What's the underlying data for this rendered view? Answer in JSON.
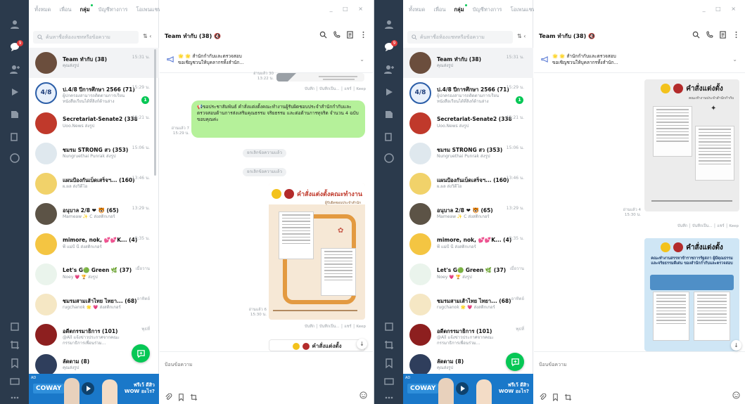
{
  "colors": {
    "rail": "#2b3a4c",
    "accent": "#06c755",
    "bubble": "#b5f19a",
    "badge": "#e23b3b",
    "adBlue": "#1a78c9"
  },
  "nav": {
    "tabs": [
      "ทั้งหมด",
      "เพื่อน",
      "กลุ่ม",
      "บัญชีทางการ",
      "โอเพนแชท",
      "⇄"
    ]
  },
  "search": {
    "placeholder": "ค้นหาชื่อห้องแชทหรือข้อความ"
  },
  "rail_badge": "9",
  "chats": [
    {
      "name": "Team ทำกับ (38)",
      "sub": "คุณส่งรูป",
      "time": "15:31 น."
    },
    {
      "name": "ป.4/8 ปีการศึกษา 2566 (71)",
      "sub": "ผู้ปกครองสามารถติดตามการเรียน หนังสือเรียนได้ที่ลิงก์ด้านล่าง",
      "time": "15:29 น.",
      "unread": "1",
      "logo": "4/8"
    },
    {
      "name": "Secretariat-Senate2 (338)",
      "sub": "Uoo.News ส่งรูป",
      "time": "15:21 น."
    },
    {
      "name": "ชมรม STRONG สว (353)",
      "sub": "Nungruethai Punrak ส่งรูป",
      "time": "15:06 น."
    },
    {
      "name": "แผนป้องกันเบ็ดเสร็จฯ... (160)",
      "sub": "ผ.ผล ส่งวิดีโอ",
      "time": "13:46 น."
    },
    {
      "name": "อนุบาล 2/8 ❤ 🐯 (65)",
      "sub": "Mameaw ✨ C ส่งสติกเกอร์",
      "time": "13:29 น."
    },
    {
      "name": "mimore, nok, 💕💕K... (4)",
      "sub": "พี่ แม่ป้ นี่ ส่งสติกเกอร์",
      "time": "8:35 น."
    },
    {
      "name": "Let's G🟢 Green 🌿 (37)",
      "sub": "Noey 💗 🏆 ส่งรูป",
      "time": "เมื่อวาน"
    },
    {
      "name": "ชมรมสามเส้าไทย ไทยา... (68)",
      "sub": "rugchanok 🌟 💗 ส่งสติกเกอร์",
      "time": "อาทิตย์"
    },
    {
      "name": "อดีตกรรมาธิการ (101)",
      "sub": "@All แจ้งข่าวประกาศจากคณะกรรมาธิการเพื่อนร่วม...",
      "time": "พุธที่"
    },
    {
      "name": "ลัดดาม (8)",
      "sub": "คุณส่งรูป",
      "time": ""
    }
  ],
  "ad": {
    "tag": "AD",
    "brand": "COWAY",
    "slogan1": "ฟรีเว้ ดีสิว",
    "slogan2": "WOW อะไร?"
  },
  "chat": {
    "title": "Team ทำกับ (38)",
    "bell": "🔇",
    "announce_line1": "🌟 🌟 สำนักกำกับและตรวจสอบ",
    "announce_line2": "ขอเชิญชวนให้บุคลากรทั้งสำนัก...",
    "input_placeholder": "ป้อนข้อความ",
    "msg_actions": "บันทึก │ บันทึกเป็น... │ แชร์ │ Keep",
    "left": {
      "meta_top": "อ่านแล้ว 30 13:22 น.",
      "green_msg": "📢ขอประชาสัมพันธ์ คำสั่งแต่งตั้งคณะทำงานผู้รับผิดชอบประจำสำนักกำกับและตรวจสอบด้านการส่งเสริมคุณธรรม จริยธรรม และต่อต้านการทุจริต จำนวน 4 ฉบับ ขอบคุณค่ะ",
      "meta_green": "อ่านแล้ว 7 15:29 น.",
      "sys1": "ยกเลิกข้อความแล้ว",
      "sys2": "ยกเลิกข้อความแล้ว",
      "poster1_title": "คำสั่งแต่งตั้งคณะทำงาน",
      "poster1_sub": "ผู้รับผิดชอบประจำสำนัก",
      "meta_img": "อ่านแล้ว 6 15:30 น.",
      "poster2_title": "คำสั่งแต่งตั้ง"
    },
    "right": {
      "poster1_title": "คำสั่งแต่งตั้ง",
      "poster1_sub": "คณะทำงานประจำสำนักกำกับ",
      "meta_img": "อ่านแล้ว 4 15:30 น.",
      "poster2_title": "คำสั่งแต่งตั้ง",
      "poster2_sub": "คณะทำงานสรรหาข้าราชการรัฐสภา ผู้มีคุณธรรมและจริยธรรมดีเด่น ของสำนักกำกับและตรวจสอบ"
    }
  }
}
